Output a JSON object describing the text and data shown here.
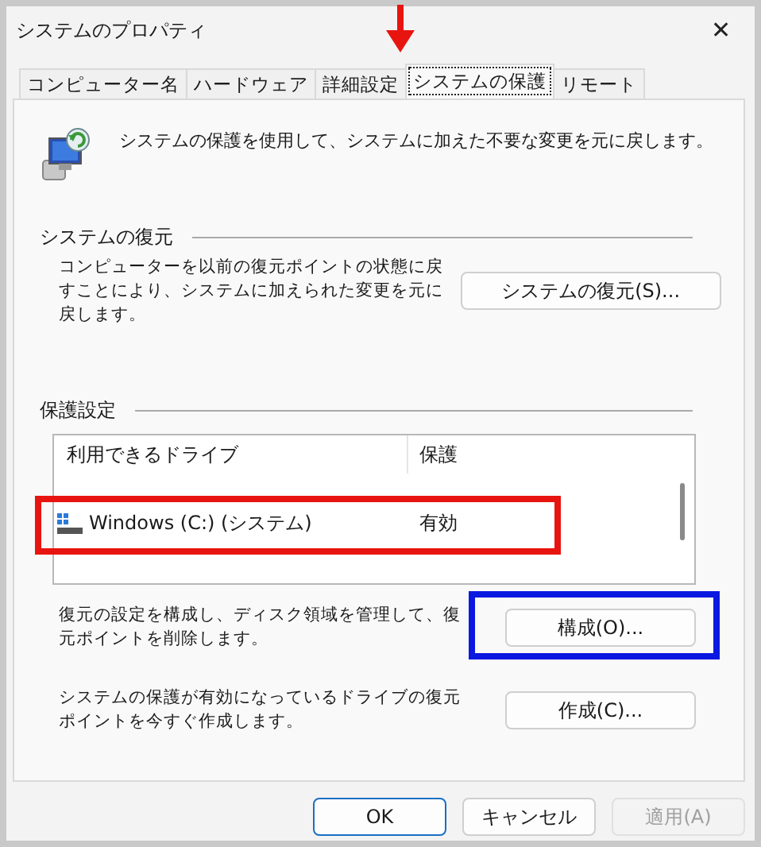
{
  "window": {
    "title": "システムのプロパティ",
    "close": "✕"
  },
  "tabs": [
    {
      "label": "コンピューター名",
      "selected": false
    },
    {
      "label": "ハードウェア",
      "selected": false
    },
    {
      "label": "詳細設定",
      "selected": false
    },
    {
      "label": "システムの保護",
      "selected": true
    },
    {
      "label": "リモート",
      "selected": false
    }
  ],
  "intro": "システムの保護を使用して、システムに加えた不要な変更を元に戻します。",
  "restore": {
    "heading": "システムの復元",
    "text": "コンピューターを以前の復元ポイントの状態に戻すことにより、システムに加えられた変更を元に戻します。",
    "button": "システムの復元(S)..."
  },
  "protection": {
    "heading": "保護設定",
    "columns": [
      "利用できるドライブ",
      "保護"
    ],
    "rows": [
      {
        "drive": "Windows (C:) (システム)",
        "status": "有効",
        "kind": "system"
      }
    ],
    "actions": [
      {
        "text": "復元の設定を構成し、ディスク領域を管理して、復元ポイントを削除します。",
        "button": "構成(O)..."
      },
      {
        "text": "システムの保護が有効になっているドライブの復元ポイントを今すぐ作成します。",
        "button": "作成(C)..."
      }
    ]
  },
  "buttons": [
    {
      "label": "OK",
      "kind": "default",
      "disabled": false
    },
    {
      "label": "キャンセル",
      "kind": "normal",
      "disabled": false
    },
    {
      "label": "適用(A)",
      "kind": "normal",
      "disabled": true
    }
  ],
  "annotations": [
    {
      "kind": "arrow",
      "color": "#e8140f"
    },
    {
      "kind": "box",
      "color": "#e8140f"
    },
    {
      "kind": "box",
      "color": "#0a18e0"
    }
  ]
}
